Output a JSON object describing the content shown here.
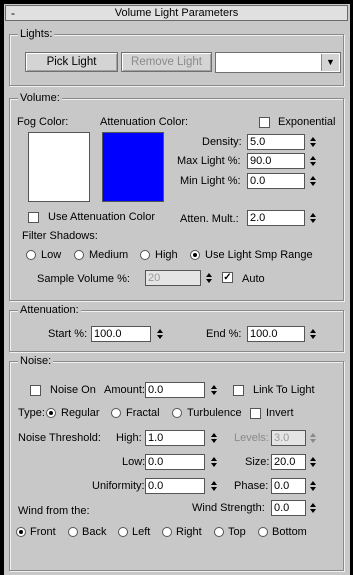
{
  "rollout": {
    "title": "Volume Light Parameters",
    "collapse_glyph": "-"
  },
  "lights": {
    "group_label": "Lights:",
    "pick_light": "Pick Light",
    "remove_light": "Remove Light",
    "light_list_value": ""
  },
  "volume": {
    "group_label": "Volume:",
    "fog_color_label": "Fog Color:",
    "attenuation_color_label": "Attenuation Color:",
    "fog_color": "#ffffff",
    "attenuation_color": "#0000ff",
    "exponential_label": "Exponential",
    "exponential_checked": false,
    "density_label": "Density:",
    "density_value": "5.0",
    "max_light_label": "Max Light %:",
    "max_light_value": "90.0",
    "min_light_label": "Min Light %:",
    "min_light_value": "0.0",
    "use_atten_color_label": "Use Attenuation Color",
    "use_atten_color_checked": false,
    "atten_mult_label": "Atten. Mult.:",
    "atten_mult_value": "2.0",
    "filter_shadows_label": "Filter Shadows:",
    "filter_options": [
      "Low",
      "Medium",
      "High",
      "Use Light Smp Range"
    ],
    "filter_selected": "Use Light Smp Range",
    "sample_volume_label": "Sample Volume %:",
    "sample_volume_value": "20",
    "auto_label": "Auto",
    "auto_checked": true
  },
  "attenuation": {
    "group_label": "Attenuation:",
    "start_label": "Start %:",
    "start_value": "100.0",
    "end_label": "End %:",
    "end_value": "100.0"
  },
  "noise": {
    "group_label": "Noise:",
    "noise_on_label": "Noise On",
    "noise_on_checked": false,
    "amount_label": "Amount:",
    "amount_value": "0.0",
    "link_to_light_label": "Link To Light",
    "link_to_light_checked": false,
    "type_label": "Type:",
    "type_options": [
      "Regular",
      "Fractal",
      "Turbulence"
    ],
    "type_selected": "Regular",
    "invert_label": "Invert",
    "invert_checked": false,
    "noise_threshold_label": "Noise Threshold:",
    "high_label": "High:",
    "high_value": "1.0",
    "levels_label": "Levels:",
    "levels_value": "3.0",
    "low_label": "Low:",
    "low_value": "0.0",
    "size_label": "Size:",
    "size_value": "20.0",
    "uniformity_label": "Uniformity:",
    "uniformity_value": "0.0",
    "phase_label": "Phase:",
    "phase_value": "0.0",
    "wind_from_label": "Wind from the:",
    "wind_strength_label": "Wind Strength:",
    "wind_strength_value": "0.0",
    "wind_options": [
      "Front",
      "Back",
      "Left",
      "Right",
      "Top",
      "Bottom"
    ],
    "wind_selected": "Front"
  },
  "icons": {
    "checkmark": "✓",
    "dropdown_arrow": "▼"
  }
}
